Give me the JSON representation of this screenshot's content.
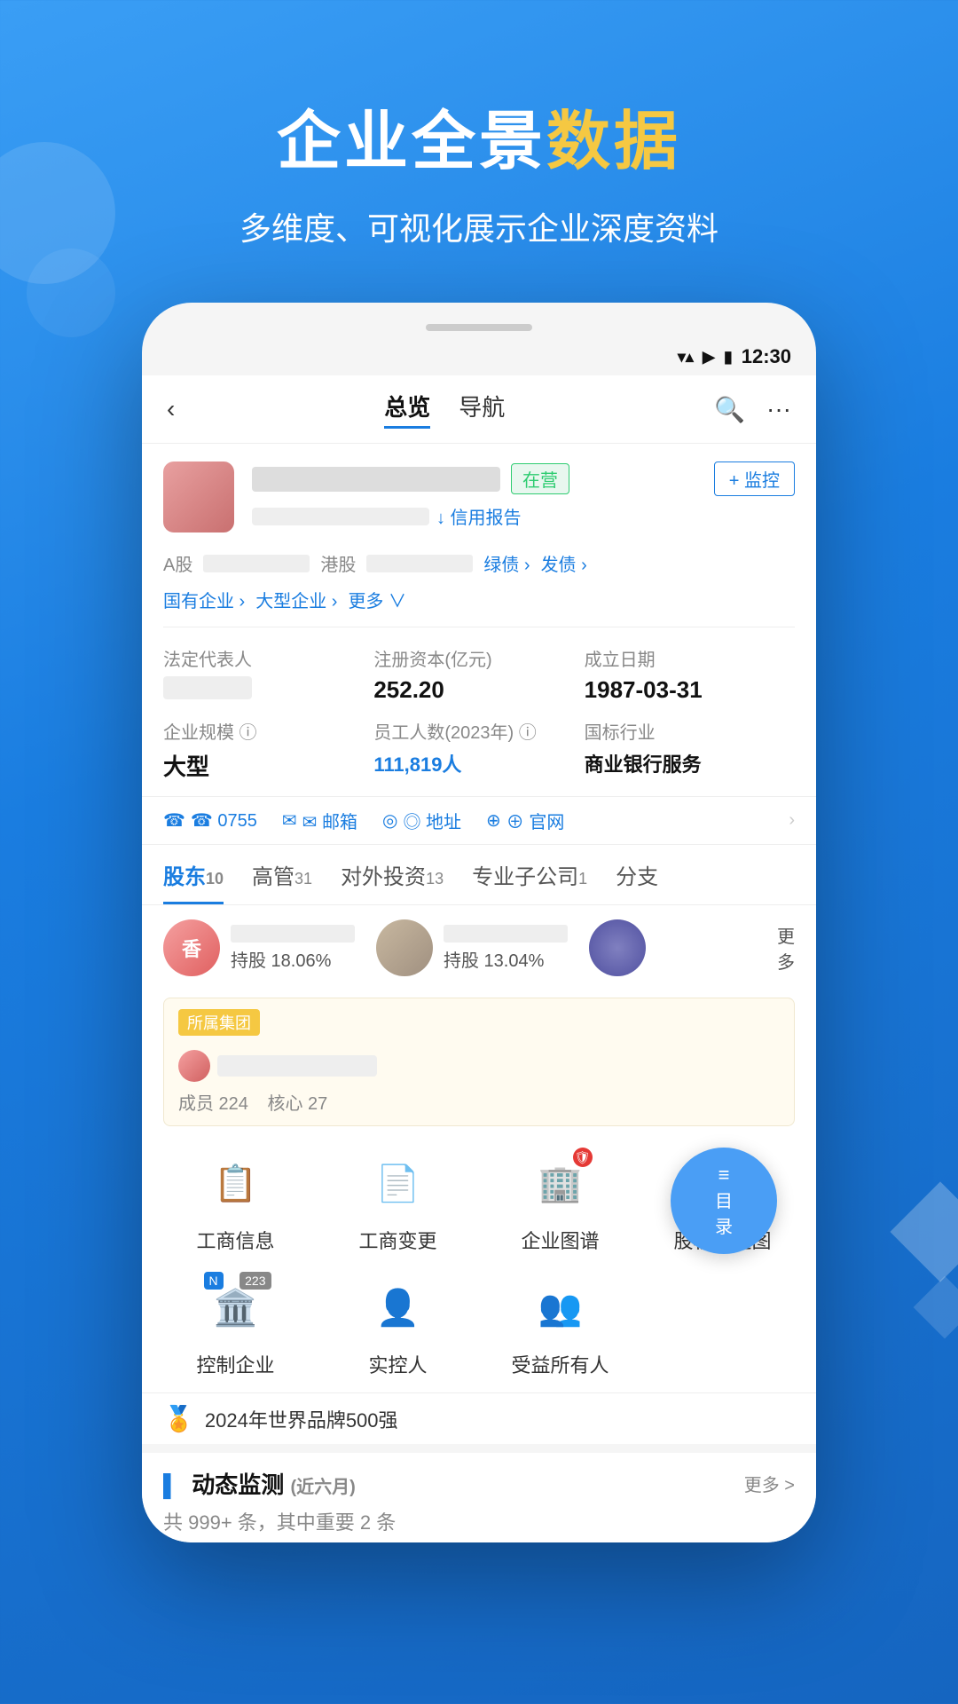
{
  "hero": {
    "title_prefix": "企业全景",
    "title_highlight": "数据",
    "subtitle": "多维度、可视化展示企业深度资料"
  },
  "status_bar": {
    "time": "12:30"
  },
  "nav": {
    "back": "‹",
    "tab_overview": "总览",
    "tab_nav": "导航",
    "search_icon": "🔍",
    "more_icon": "···"
  },
  "company": {
    "status_badge": "在营",
    "monitor_btn": "+ 监控",
    "credit_link": "↓ 信用报告",
    "stock_a_label": "A股",
    "stock_hk_label": "港股",
    "green_bond": "绿债 ›",
    "bond": "发债 ›",
    "cat1": "国有企业 ›",
    "cat2": "大型企业 ›",
    "more_cats": "更多 ∨",
    "legal_rep_label": "法定代表人",
    "reg_capital_label": "注册资本(亿元)",
    "reg_capital_value": "252.20",
    "found_date_label": "成立日期",
    "found_date_value": "1987-03-31",
    "scale_label": "企业规模 ⓘ",
    "scale_value": "大型",
    "employees_label": "员工人数(2023年) ⓘ",
    "employees_value": "111,819人",
    "industry_label": "国标行业",
    "industry_value": "商业银行服务",
    "phone": "☎ 0755",
    "email": "✉ 邮箱",
    "address": "◎ 地址",
    "website": "⊕ 官网"
  },
  "tabs": [
    {
      "label": "股东",
      "count": "10"
    },
    {
      "label": "高管",
      "count": "31"
    },
    {
      "label": "对外投资",
      "count": "13"
    },
    {
      "label": "专业子公司",
      "count": "1"
    },
    {
      "label": "分支",
      "count": ""
    }
  ],
  "shareholders": [
    {
      "avatar_text": "香",
      "percent": "持股 18.06%"
    },
    {
      "percent": "持股 13.04%"
    }
  ],
  "group": {
    "label": "所属集团",
    "members": "成员 224",
    "core": "核心 27"
  },
  "functions": [
    {
      "icon": "📋",
      "label": "工商信息",
      "badge": ""
    },
    {
      "icon": "📄",
      "label": "工商变更",
      "badge": ""
    },
    {
      "icon": "🏢",
      "label": "企业图谱",
      "badge": "red"
    },
    {
      "icon": "🔗",
      "label": "股权穿透图",
      "badge": ""
    },
    {
      "icon": "🏛️",
      "label": "控制企业",
      "badge_n": "N",
      "badge_num": "223"
    },
    {
      "icon": "👤",
      "label": "实控人",
      "badge": ""
    },
    {
      "icon": "👥",
      "label": "受益所有人",
      "badge": ""
    }
  ],
  "honor": {
    "icon": "🏅",
    "text": "2024年世界品牌500强"
  },
  "dynamic": {
    "title": "动态监测",
    "subtitle": "(近六月)",
    "more": "更多 >",
    "stats": "共 999+ 条，其中重要 2 条"
  },
  "float_btn": {
    "line1": "目",
    "line2": "录"
  }
}
